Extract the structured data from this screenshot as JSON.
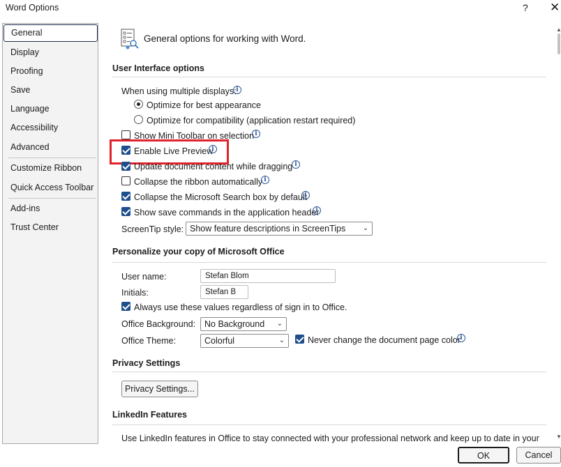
{
  "window": {
    "title": "Word Options",
    "help": "?",
    "close": "✕"
  },
  "nav": {
    "items": [
      {
        "label": "General"
      },
      {
        "label": "Display"
      },
      {
        "label": "Proofing"
      },
      {
        "label": "Save"
      },
      {
        "label": "Language"
      },
      {
        "label": "Accessibility"
      },
      {
        "label": "Advanced"
      },
      {
        "label": "Customize Ribbon"
      },
      {
        "label": "Quick Access Toolbar"
      },
      {
        "label": "Add-ins"
      },
      {
        "label": "Trust Center"
      }
    ],
    "selected": "General"
  },
  "header": {
    "title": "General options for working with Word.",
    "icon": "general-options-icon"
  },
  "ui_options": {
    "section_title": "User Interface options",
    "multiple_displays_label": "When using multiple displays:",
    "radio_best": "Optimize for best appearance",
    "radio_compat": "Optimize for compatibility (application restart required)",
    "mini_toolbar": "Show Mini Toolbar on selection",
    "live_preview": "Enable Live Preview",
    "update_dragging": "Update document content while dragging",
    "collapse_ribbon": "Collapse the ribbon automatically",
    "collapse_search": "Collapse the Microsoft Search box by default",
    "show_save": "Show save commands in the application header",
    "screentip_label": "ScreenTip style:",
    "screentip_value": "Show feature descriptions in ScreenTips"
  },
  "personalize": {
    "section_title": "Personalize your copy of Microsoft Office",
    "username_label": "User name:",
    "username_value": "Stefan Blom",
    "initials_label": "Initials:",
    "initials_value": "Stefan B",
    "always_use": "Always use these values regardless of sign in to Office.",
    "background_label": "Office Background:",
    "background_value": "No Background",
    "theme_label": "Office Theme:",
    "theme_value": "Colorful",
    "never_change": "Never change the document page color"
  },
  "privacy": {
    "section_title": "Privacy Settings",
    "button": "Privacy Settings..."
  },
  "linkedin": {
    "section_title": "LinkedIn Features",
    "description": "Use LinkedIn features in Office to stay connected with your professional network and keep up to date in your"
  },
  "footer": {
    "ok": "OK",
    "cancel": "Cancel"
  },
  "colors": {
    "accent": "#1e4e8c",
    "highlight": "#e0222b"
  }
}
